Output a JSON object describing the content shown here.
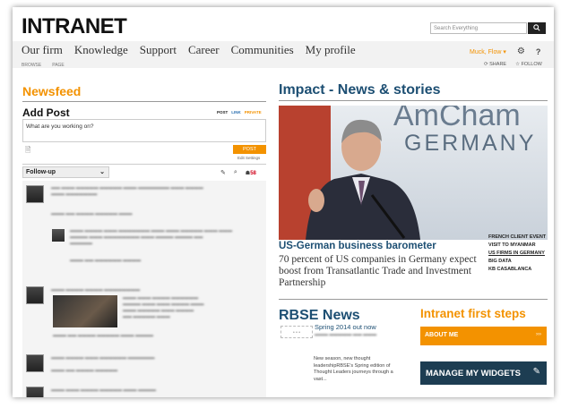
{
  "header": {
    "logo": "INTRANET",
    "search_placeholder": "Search Everything",
    "search_button_icon": "search-icon"
  },
  "nav": {
    "items": [
      "Our firm",
      "Knowledge",
      "Support",
      "Career",
      "Communities",
      "My profile"
    ],
    "sub_items": [
      "BROWSE",
      "PAGE"
    ],
    "user_label": "Muck, Flow",
    "share": "SHARE",
    "follow": "FOLLOW"
  },
  "newsfeed": {
    "title": "Newsfeed",
    "add_post_title": "Add Post",
    "post_tabs": [
      "POST",
      "LINK",
      "PRIVATE"
    ],
    "composer_placeholder": "What are you working on?",
    "post_button": "POST",
    "edit_settings": "Edit Settings",
    "filter_selected": "Follow-up",
    "badge_count": "58"
  },
  "impact": {
    "title": "Impact - News & stories",
    "hero_banner_line1": "AmCham",
    "hero_banner_line2": "GERMANY",
    "headline": "US-German business barometer",
    "summary": "70 percent of US companies in Germany expect boost from Transatlantic Trade and Investment Partnership",
    "side_links": [
      "FRENCH CLIENT EVENT",
      "VISIT TO MYANMAR",
      "US FIRMS IN GERMANY",
      "BIG DATA",
      "KB CASABLANCA"
    ]
  },
  "rbse": {
    "title": "RBSE News",
    "item_title": "Spring 2014 out now",
    "item_text": "New season, new thought leadershipRBSE's Spring edition of Thought Leaders journeys through a vast..."
  },
  "first_steps": {
    "title": "Intranet first steps",
    "about_me": "ABOUT ME",
    "manage_widgets": "MANAGE MY WIDGETS"
  },
  "colors": {
    "accent_orange": "#f39200",
    "heading_blue": "#1d4f73",
    "navy_button": "#1d3d52"
  }
}
